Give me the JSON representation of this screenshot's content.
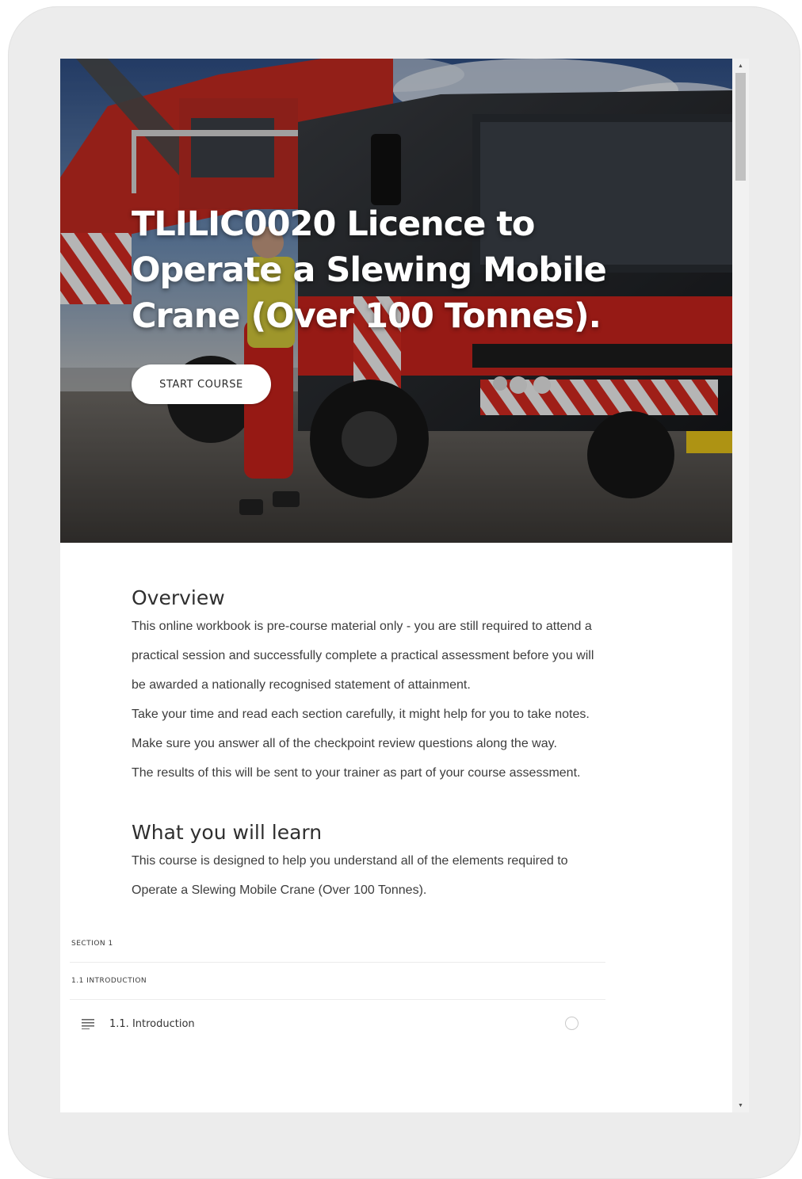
{
  "hero": {
    "title": "TLILIC0020 Licence to Operate a Slewing Mobile Crane (Over 100 Tonnes).",
    "start_button": "START COURSE"
  },
  "overview": {
    "heading": "Overview",
    "lines": [
      "This online workbook is pre-course material only - you are still required to attend a",
      "practical session and successfully complete a practical assessment before you will",
      "be awarded a nationally recognised statement of attainment.",
      "Take your time and read each section carefully, it might help for you to take notes.",
      "Make sure you answer all of the checkpoint review questions along the way.",
      "The results of this will be sent to your trainer as part of your course assessment."
    ]
  },
  "learn": {
    "heading": "What you will learn",
    "lines": [
      "This course is designed to help you understand all of the elements required to",
      "Operate a Slewing Mobile Crane (Over 100 Tonnes)."
    ]
  },
  "outline": {
    "section_label": "SECTION 1",
    "subsection_label": "1.1 INTRODUCTION",
    "lesson_title": "1.1. Introduction",
    "lesson_icon": "text-lines-icon"
  },
  "colors": {
    "hero_red": "#c8231c",
    "button_bg": "#ffffff",
    "text": "#3d3d3d"
  }
}
